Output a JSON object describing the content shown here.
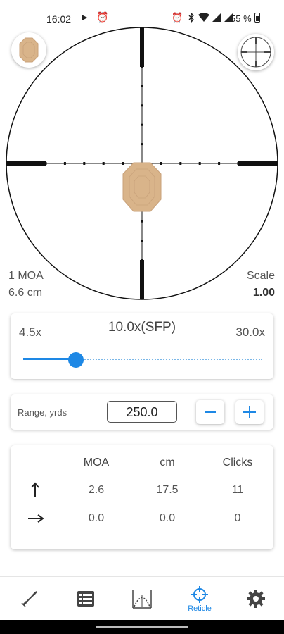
{
  "status_bar": {
    "time": "16:02",
    "battery_text": "55 %",
    "icons": [
      "play-icon",
      "alarm-icon",
      "alarm-icon",
      "bluetooth-icon",
      "wifi-icon",
      "signal-icon",
      "signal-icon",
      "battery-icon"
    ]
  },
  "scope": {
    "reticle_unit": "1 MOA",
    "reticle_size": "6.6 cm",
    "scale_label": "Scale",
    "scale_value": "1.00"
  },
  "zoom": {
    "min_label": "4.5x",
    "current_label": "10.0x(SFP)",
    "max_label": "30.0x",
    "position_fraction": 0.22
  },
  "range": {
    "label": "Range, yrds",
    "value": "250.0",
    "minus_icon": "minus-icon",
    "plus_icon": "plus-icon"
  },
  "corrections": {
    "headers": [
      "MOA",
      "cm",
      "Clicks"
    ],
    "rows": [
      {
        "icon": "arrow-up-icon",
        "moa": "2.6",
        "cm": "17.5",
        "clicks": "11"
      },
      {
        "icon": "arrow-right-icon",
        "moa": "0.0",
        "cm": "0.0",
        "clicks": "0"
      }
    ]
  },
  "nav": {
    "items": [
      {
        "icon": "bullet-icon",
        "label": ""
      },
      {
        "icon": "list-icon",
        "label": ""
      },
      {
        "icon": "trajectory-icon",
        "label": ""
      },
      {
        "icon": "crosshair-icon",
        "label": "Reticle"
      },
      {
        "icon": "gear-icon",
        "label": ""
      }
    ]
  },
  "colors": {
    "accent": "#1e88e5",
    "target": "#d9b48a",
    "reticle": "#000000"
  }
}
